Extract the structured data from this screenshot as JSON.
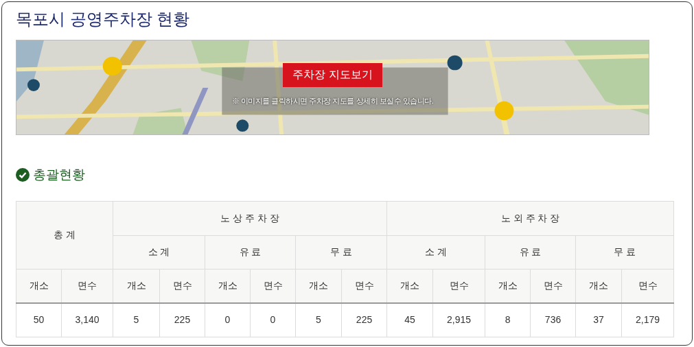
{
  "title": "목포시 공영주차장 현황",
  "map": {
    "button": "주차장 지도보기",
    "notice": "※ 이미지를 클릭하시면 주차장 지도를 상세히 보실수 있습니다."
  },
  "section_title": "총괄현황",
  "table": {
    "total_label": "총 계",
    "groups": [
      {
        "label": "노 상 주 차 장",
        "subgroups": [
          "소 계",
          "유 료",
          "무 료"
        ]
      },
      {
        "label": "노 외 주 차 장",
        "subgroups": [
          "소 계",
          "유 료",
          "무 료"
        ]
      }
    ],
    "unit_columns": [
      "개소",
      "면수",
      "개소",
      "면수",
      "개소",
      "면수",
      "개소",
      "면수",
      "개소",
      "면수",
      "개소",
      "면수",
      "개소",
      "면수"
    ],
    "row": [
      "50",
      "3,140",
      "5",
      "225",
      "0",
      "0",
      "5",
      "225",
      "45",
      "2,915",
      "8",
      "736",
      "37",
      "2,179"
    ]
  }
}
